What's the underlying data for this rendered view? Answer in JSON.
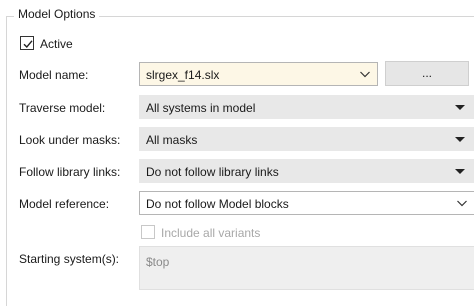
{
  "group": {
    "title": "Model Options"
  },
  "active": {
    "label": "Active",
    "checked": true
  },
  "model_name": {
    "label": "Model name:",
    "value": "slrgex_f14.slx",
    "browse_label": "..."
  },
  "traverse_model": {
    "label": "Traverse model:",
    "value": "All systems in model"
  },
  "look_under_masks": {
    "label": "Look under masks:",
    "value": "All masks"
  },
  "follow_library_links": {
    "label": "Follow library links:",
    "value": "Do not follow library links"
  },
  "model_reference": {
    "label": "Model reference:",
    "value": "Do not follow Model blocks"
  },
  "include_variants": {
    "label": "Include all variants",
    "checked": false,
    "enabled": false
  },
  "starting_system": {
    "label": "Starting system(s):",
    "value": "$top"
  }
}
